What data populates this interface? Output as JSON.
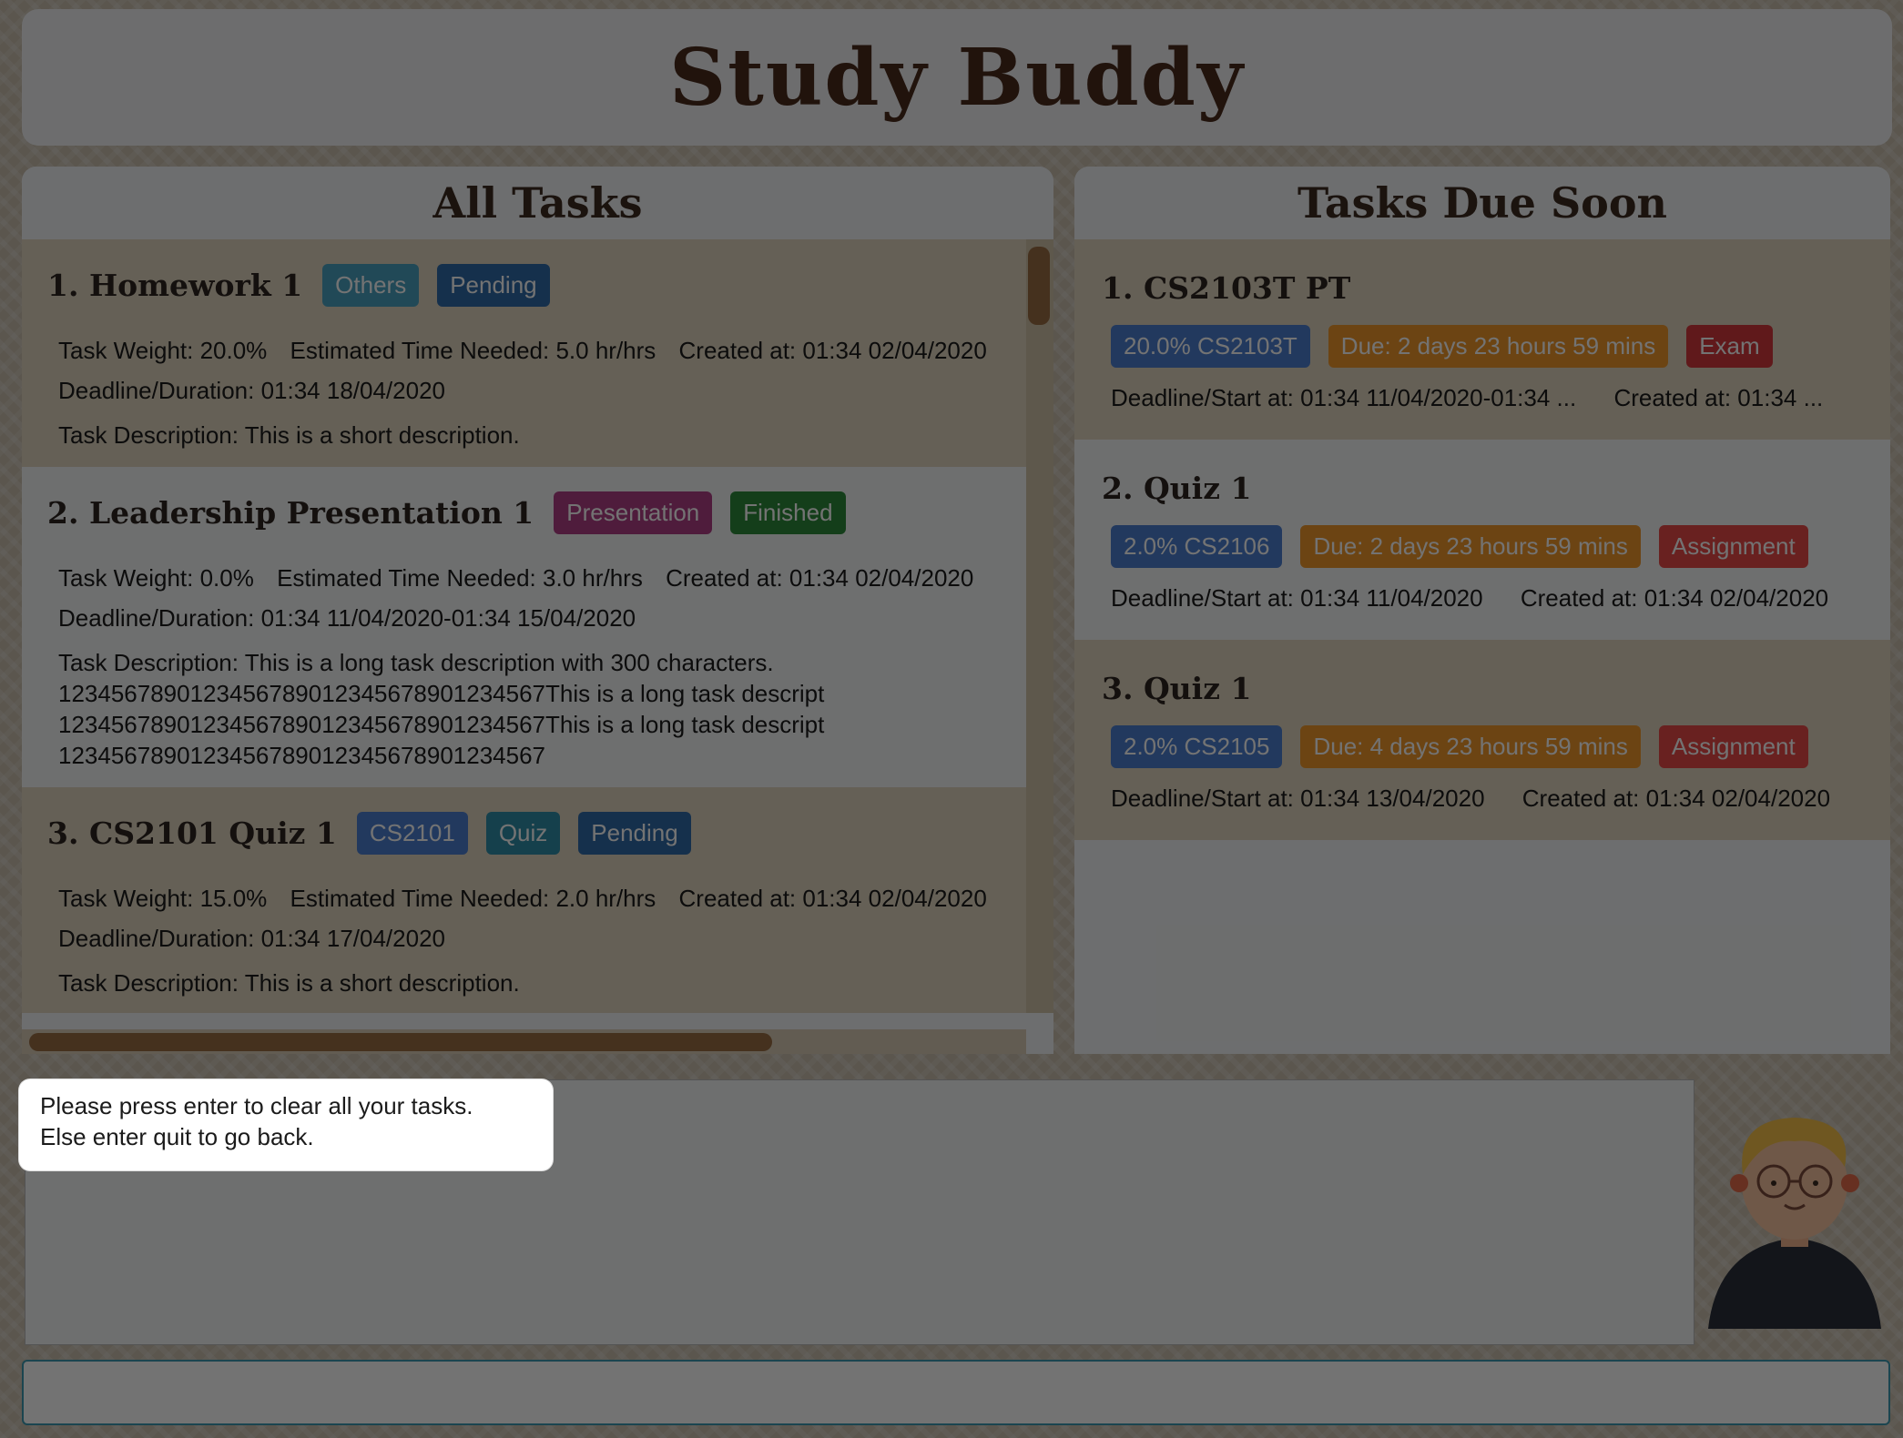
{
  "header": {
    "title": "Study Buddy"
  },
  "all_tasks": {
    "title": "All Tasks",
    "tasks": [
      {
        "title": "1.  Homework 1",
        "tags": [
          {
            "label": "Others",
            "color": "#4aa3c2"
          },
          {
            "label": "Pending",
            "color": "#2f6aa8"
          }
        ],
        "weight": "Task Weight: 20.0%",
        "time": "Estimated Time Needed: 5.0 hr/hrs",
        "created": "Created at: 01:34 02/04/2020",
        "deadline": "Deadline/Duration: 01:34 18/04/2020",
        "description": "Task Description: This is a short description."
      },
      {
        "title": "2.  Leadership Presentation 1",
        "tags": [
          {
            "label": "Presentation",
            "color": "#b03e86"
          },
          {
            "label": "Finished",
            "color": "#2e8b3a"
          }
        ],
        "weight": "Task Weight: 0.0%",
        "time": "Estimated Time Needed: 3.0 hr/hrs",
        "created": "Created at: 01:34 02/04/2020",
        "deadline": "Deadline/Duration: 01:34 11/04/2020-01:34 15/04/2020",
        "description": "Task Description: This is a long task description with 300 characters.\n1234567890123456789012345678901234567This is a long task descript\n1234567890123456789012345678901234567This is a long task descript\n1234567890123456789012345678901234567"
      },
      {
        "title": "3.  CS2101 Quiz 1",
        "tags": [
          {
            "label": "CS2101",
            "color": "#4c7fd0"
          },
          {
            "label": "Quiz",
            "color": "#2f8fa8"
          },
          {
            "label": "Pending",
            "color": "#2f6aa8"
          }
        ],
        "weight": "Task Weight: 15.0%",
        "time": "Estimated Time Needed: 2.0 hr/hrs",
        "created": "Created at: 01:34 02/04/2020",
        "deadline": "Deadline/Duration: 01:34 17/04/2020",
        "description": "Task Description: This is a short description."
      }
    ]
  },
  "due_soon": {
    "title": "Tasks Due Soon",
    "tasks": [
      {
        "title": "1.  CS2103T PT",
        "tags": [
          {
            "label": "20.0% CS2103T",
            "color": "#4c7fd0"
          },
          {
            "label": "Due: 2 days 23 hours 59 mins",
            "color": "#f0982c"
          },
          {
            "label": "Exam",
            "color": "#d6383c"
          }
        ],
        "deadline": "Deadline/Start at: 01:34 11/04/2020-01:34 ...",
        "created": "Created at: 01:34 ..."
      },
      {
        "title": "2.  Quiz 1",
        "tags": [
          {
            "label": "2.0% CS2106",
            "color": "#4c7fd0"
          },
          {
            "label": "Due: 2 days 23 hours 59 mins",
            "color": "#f0982c"
          },
          {
            "label": "Assignment",
            "color": "#e94a48"
          }
        ],
        "deadline": "Deadline/Start at: 01:34 11/04/2020",
        "created": "Created at: 01:34 02/04/2020"
      },
      {
        "title": "3.  Quiz 1",
        "tags": [
          {
            "label": "2.0% CS2105",
            "color": "#4c7fd0"
          },
          {
            "label": "Due: 4 days 23 hours 59 mins",
            "color": "#f0982c"
          },
          {
            "label": "Assignment",
            "color": "#e94a48"
          }
        ],
        "deadline": "Deadline/Start at: 01:34 13/04/2020",
        "created": "Created at: 01:34 02/04/2020"
      }
    ]
  },
  "popup": {
    "line1": "Please press enter to clear all your tasks.",
    "line2": "Else enter quit to go back."
  },
  "command_box": {
    "value": ""
  },
  "colors": {
    "accent": "#3c9ab2",
    "brand_text": "#4a2a1c",
    "scrollbar": "#9a6d44"
  }
}
